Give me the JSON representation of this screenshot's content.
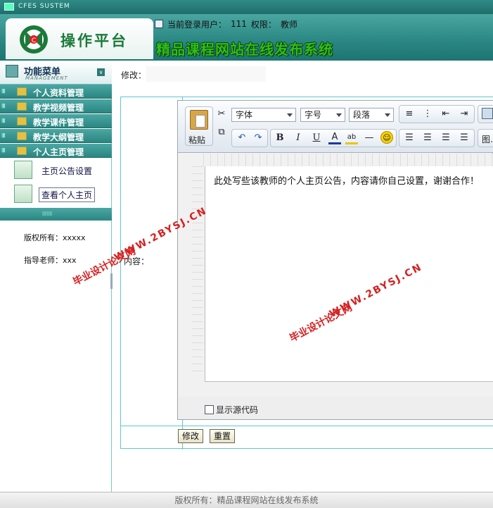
{
  "system": {
    "label": "CFES SUSTEM"
  },
  "header": {
    "logo_text": "操作平台",
    "user_label": "当前登录用户：",
    "user_value": "111",
    "role_label": "权限：",
    "role_value": "教师",
    "site_title": "精品课程网站在线发布系统"
  },
  "sidebar": {
    "menu_title": "功能菜单",
    "menu_subtitle": "MANAGEMENT",
    "items": [
      {
        "label": "个人资料管理"
      },
      {
        "label": "教学视频管理"
      },
      {
        "label": "教学课件管理"
      },
      {
        "label": "教学大纲管理"
      },
      {
        "label": "个人主页管理"
      }
    ],
    "sub_items": [
      {
        "label": "主页公告设置"
      },
      {
        "label": "查看个人主页"
      }
    ],
    "copyright": "版权所有：xxxxx",
    "advisor": "指导老师：xxx"
  },
  "form": {
    "modify_label": "修改：",
    "modify_value": "",
    "content_label": "内容：",
    "submit_label": "修改",
    "reset_label": "重置"
  },
  "editor": {
    "paste_label": "粘贴",
    "font_select": "字体",
    "size_select": "字号",
    "paragraph_select": "段落",
    "image_label": "图.",
    "content_text": "此处写些该教师的个人主页公告，内容请你自己设置，谢谢合作！",
    "show_source_label": "显示源代码"
  },
  "watermark": {
    "line1": "毕业设计论文网",
    "line2": "WWW.2BYSJ.CN"
  },
  "footer": {
    "text": "版权所有：精品课程网站在线发布系统"
  }
}
